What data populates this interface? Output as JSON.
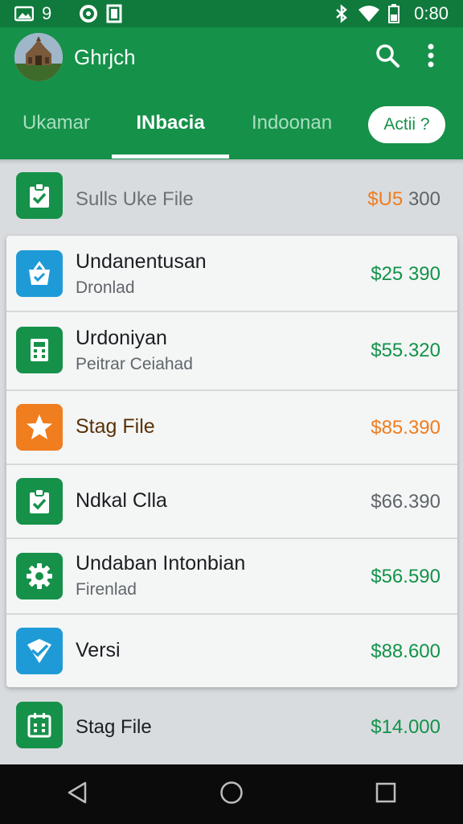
{
  "status_bar": {
    "left_number": "9",
    "time": "0:80",
    "icons": [
      "image-icon",
      "circle-notification-icon",
      "square-notification-icon",
      "bluetooth-icon",
      "wifi-icon",
      "battery-icon"
    ]
  },
  "app_bar": {
    "title": "Ghrjch",
    "search_icon": "search-icon",
    "more_icon": "more-vert-icon"
  },
  "tabs": [
    {
      "label": "Ukamar",
      "active": false
    },
    {
      "label": "INbacia",
      "active": true
    },
    {
      "label": "Indoonan",
      "active": false
    }
  ],
  "tab_chip": {
    "label": "Actii ?"
  },
  "colors": {
    "primary": "#16914a",
    "status_bar": "#0f7a3c",
    "green_amount": "#12934a",
    "orange_amount": "#f07d1e",
    "icon_green": "#16914a",
    "icon_blue": "#1e9bd7",
    "icon_orange": "#f07d1e"
  },
  "top_row": {
    "title": "Sulls Uke File",
    "amount_prefix": "$U5",
    "amount_rest": " 300",
    "icon": "clipboard-check-icon"
  },
  "card_rows": [
    {
      "title": "Undanentusan",
      "subtitle": "Dronlad",
      "amount": "$25 390",
      "icon": "basket-check-icon",
      "icon_color": "#1e9bd7",
      "amount_color": "green"
    },
    {
      "title": "Urdoniyan",
      "subtitle": "Peitrar Ceiahad",
      "amount": "$55.320",
      "icon": "calculator-icon",
      "icon_color": "#16914a",
      "amount_color": "green"
    },
    {
      "title": "Stag File",
      "subtitle": "",
      "amount": "$85.390",
      "icon": "star-icon",
      "icon_color": "#f07d1e",
      "amount_color": "orange"
    },
    {
      "title": "Ndkal Clla",
      "subtitle": "",
      "amount": "$66.390",
      "icon": "clipboard-check-icon",
      "icon_color": "#16914a",
      "amount_color": "gray"
    },
    {
      "title": "Undaban Intonbian",
      "subtitle": "Firenlad",
      "amount": "$56.590",
      "icon": "gear-icon",
      "icon_color": "#16914a",
      "amount_color": "green"
    },
    {
      "title": "Versi",
      "subtitle": "",
      "amount": "$88.600",
      "icon": "check-envelope-icon",
      "icon_color": "#1e9bd7",
      "amount_color": "green"
    }
  ],
  "bottom_row": {
    "title": "Stag File",
    "amount": "$14.000",
    "icon": "calendar-icon"
  },
  "nav_bar": {
    "back_icon": "back-triangle-icon",
    "home_icon": "home-circle-icon",
    "recents_icon": "recents-square-icon"
  }
}
